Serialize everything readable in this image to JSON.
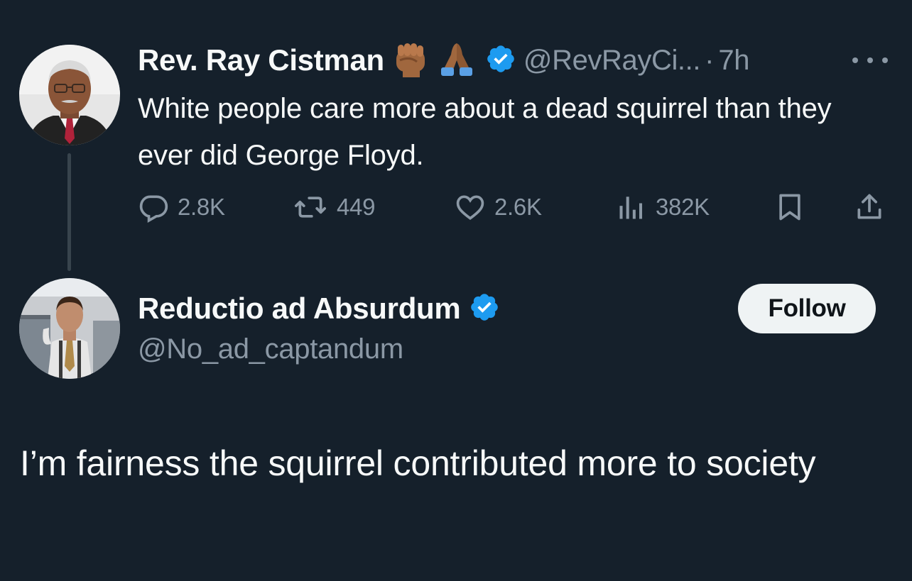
{
  "original_tweet": {
    "author_name": "Rev. Ray Cistman",
    "emojis": [
      "raised-fist-medium-dark-icon",
      "folded-hands-medium-dark-icon"
    ],
    "verified": true,
    "handle": "@RevRayCi...",
    "separator": "·",
    "time": "7h",
    "text": "White people care more about a dead squirrel than they ever did George Floyd.",
    "metrics": {
      "replies": "2.8K",
      "retweets": "449",
      "likes": "2.6K",
      "views": "382K"
    }
  },
  "reply": {
    "author_name": "Reductio ad Absurdum",
    "verified": true,
    "handle": "@No_ad_captandum",
    "follow_label": "Follow",
    "text": "I’m fairness the squirrel contributed more to society"
  },
  "colors": {
    "background": "#15202b",
    "primary_text": "#f7f9f9",
    "secondary_text": "#8b98a5",
    "verified_blue": "#1d9bf0",
    "follow_bg": "#eff3f4"
  }
}
